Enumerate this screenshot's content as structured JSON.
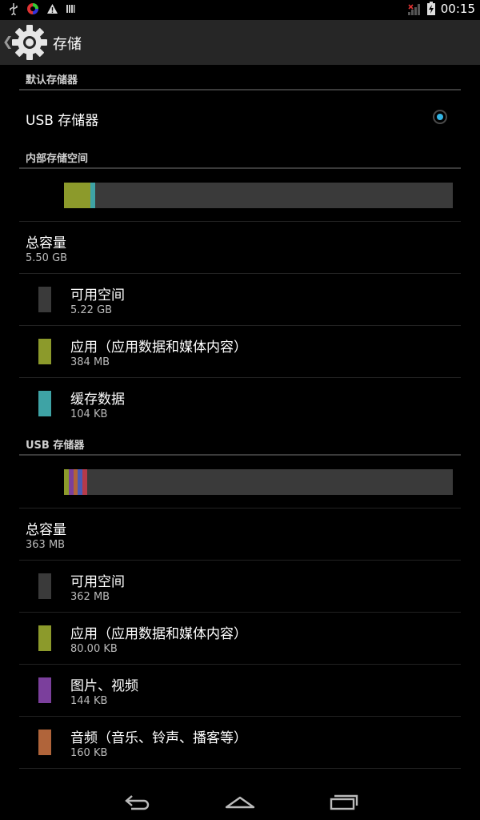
{
  "status_bar": {
    "time": "00:15",
    "icons": [
      "usb-icon",
      "color-wheel-icon",
      "warning-icon",
      "bars-icon",
      "no-signal-icon",
      "battery-charging-icon"
    ]
  },
  "action_bar": {
    "title": "存储",
    "icon": "gear-icon"
  },
  "default_storage": {
    "header": "默认存储器",
    "option_label": "USB 存储器",
    "selected": true
  },
  "internal": {
    "header": "内部存储空间",
    "usage_bar": [
      {
        "name": "apps",
        "fraction": 0.068,
        "color": "#8c9a2b"
      },
      {
        "name": "cache",
        "fraction": 0.012,
        "color": "#3ea3a5"
      }
    ],
    "total_label": "总容量",
    "total_value": "5.50 GB",
    "items": [
      {
        "label": "可用空间",
        "value": "5.22 GB",
        "color": "#3a3a3a"
      },
      {
        "label": "应用（应用数据和媒体内容）",
        "value": "384 MB",
        "color": "#8c9a2b"
      },
      {
        "label": "缓存数据",
        "value": "104 KB",
        "color": "#3ea3a5"
      }
    ]
  },
  "usb": {
    "header": "USB 存储器",
    "usage_bar": [
      {
        "name": "apps",
        "fraction": 0.012,
        "color": "#8c9a2b"
      },
      {
        "name": "pictures",
        "fraction": 0.012,
        "color": "#7b3f9c"
      },
      {
        "name": "audio",
        "fraction": 0.012,
        "color": "#b0643a"
      },
      {
        "name": "other-1",
        "fraction": 0.012,
        "color": "#4a5ab5"
      },
      {
        "name": "other-2",
        "fraction": 0.012,
        "color": "#b53a4a"
      }
    ],
    "total_label": "总容量",
    "total_value": "363 MB",
    "items": [
      {
        "label": "可用空间",
        "value": "362 MB",
        "color": "#3a3a3a"
      },
      {
        "label": "应用（应用数据和媒体内容）",
        "value": "80.00 KB",
        "color": "#8c9a2b"
      },
      {
        "label": "图片、视频",
        "value": "144 KB",
        "color": "#7b3f9c"
      },
      {
        "label": "音频（音乐、铃声、播客等）",
        "value": "160 KB",
        "color": "#b0643a"
      }
    ]
  },
  "nav": {
    "back": "back-icon",
    "home": "home-icon",
    "recents": "recents-icon"
  }
}
